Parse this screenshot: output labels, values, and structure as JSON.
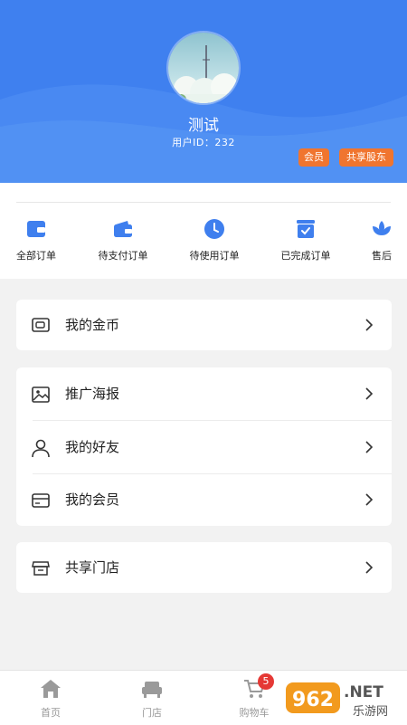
{
  "profile": {
    "name": "测试",
    "user_id": "用户ID：232",
    "badges": {
      "member": "会员",
      "shareholder": "共享股东"
    }
  },
  "orders": [
    {
      "label": "全部订单",
      "icon": "wallet-card-icon"
    },
    {
      "label": "待支付订单",
      "icon": "wallet-icon"
    },
    {
      "label": "待使用订单",
      "icon": "clock-icon"
    },
    {
      "label": "已完成订单",
      "icon": "check-box-icon"
    },
    {
      "label": "售后",
      "icon": "lotus-icon"
    }
  ],
  "menu": {
    "coins": "我的金币",
    "poster": "推广海报",
    "friends": "我的好友",
    "membership": "我的会员",
    "store": "共享门店"
  },
  "tabs": {
    "home": "首页",
    "store": "门店",
    "cart": "购物车",
    "cart_count": "5"
  },
  "watermark": {
    "number": "962",
    "net": ".NET",
    "site": "乐游网"
  },
  "colors": {
    "header": "#3f80ef",
    "accent_blue": "#3f7fee",
    "badge_orange": "#f0752f",
    "cart_badge": "#e53935"
  }
}
